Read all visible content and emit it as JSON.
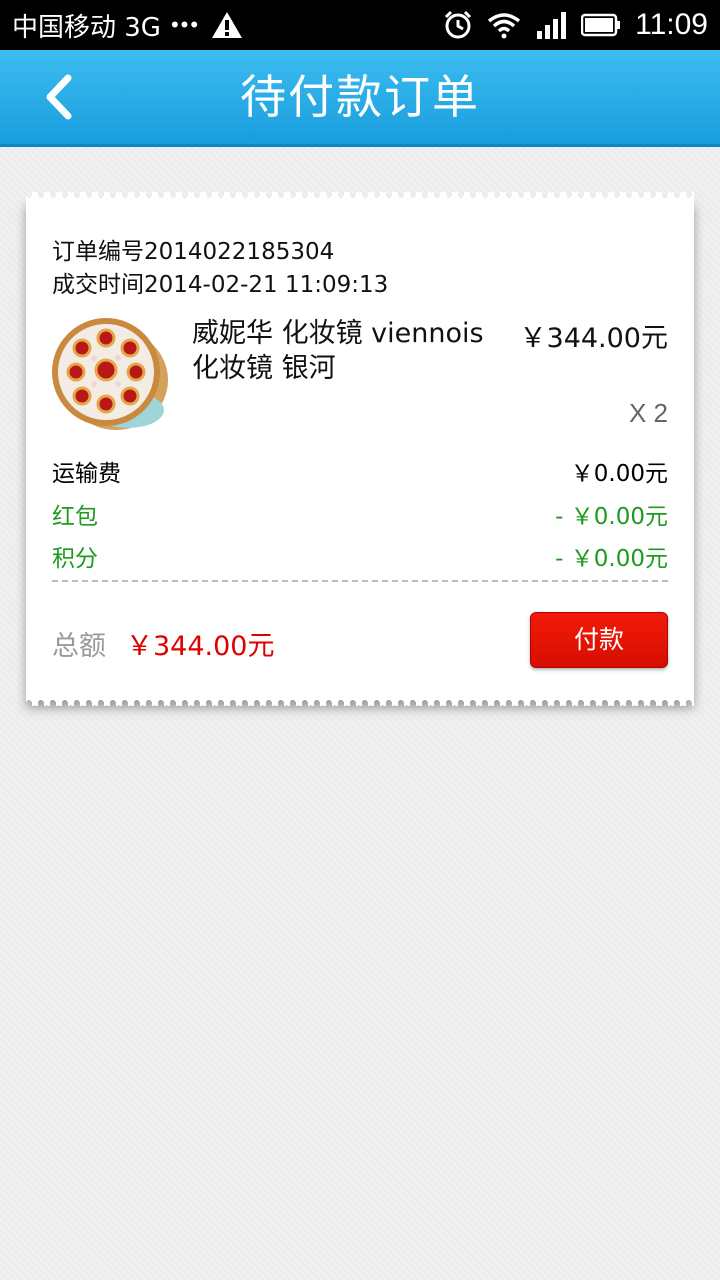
{
  "status_bar": {
    "carrier": "中国移动 3G",
    "dots": "•••",
    "time": "11:09"
  },
  "header": {
    "title": "待付款订单"
  },
  "order": {
    "number_line": "订单编号2014022185304",
    "time_line": "成交时间2014-02-21 11:09:13",
    "product": {
      "name": "威妮华 化妆镜 viennois 化妆镜 银河",
      "price": "￥344.00元",
      "quantity": "X 2"
    },
    "fees": [
      {
        "label": "运输费",
        "value": "￥0.00元"
      },
      {
        "label": "红包",
        "value": "- ￥0.00元"
      },
      {
        "label": "积分",
        "value": "- ￥0.00元"
      }
    ],
    "total_label": "总额",
    "total_value": "￥344.00元",
    "pay_button": "付款"
  },
  "colors": {
    "header_blue": "#1faae6",
    "total_red": "#e10000",
    "discount_green": "#1e9a1e",
    "pay_button_red": "#e01200"
  },
  "icons": [
    "back-arrow-icon",
    "warning-icon",
    "alarm-icon",
    "wifi-icon",
    "signal-icon",
    "battery-icon"
  ]
}
